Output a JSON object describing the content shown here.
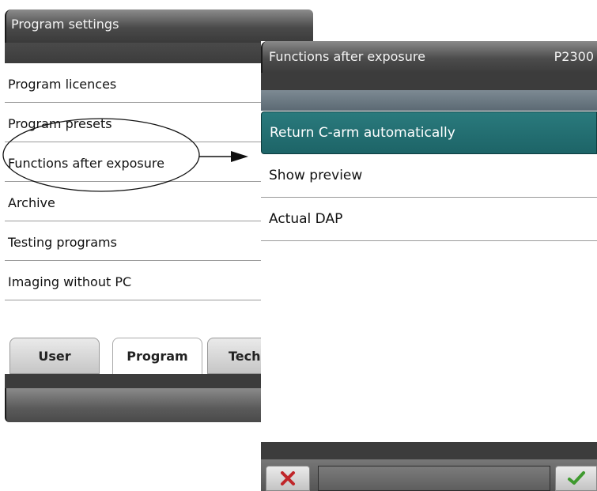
{
  "program_settings": {
    "title": "Program settings",
    "items": [
      {
        "label": "Program licences"
      },
      {
        "label": "Program presets"
      },
      {
        "label": "Functions after exposure"
      },
      {
        "label": "Archive"
      },
      {
        "label": "Testing programs"
      },
      {
        "label": "Imaging without PC"
      }
    ],
    "tabs": [
      {
        "label": "User",
        "active": false
      },
      {
        "label": "Program",
        "active": true
      },
      {
        "label": "Tech",
        "active": false
      }
    ]
  },
  "functions_after_exposure": {
    "title": "Functions after exposure",
    "code": "P2300",
    "items": [
      {
        "label": "Return C-arm automatically",
        "selected": true
      },
      {
        "label": "Show preview",
        "selected": false
      },
      {
        "label": "Actual DAP",
        "selected": false
      }
    ],
    "cancel_icon": "red-x-cancel-icon",
    "confirm_icon": "green-check-confirm-icon"
  },
  "colors": {
    "selected_item": "#2a7a7d",
    "title_bar": "#4a4a4a",
    "cancel": "#c0262a",
    "confirm": "#3f9a2f"
  }
}
